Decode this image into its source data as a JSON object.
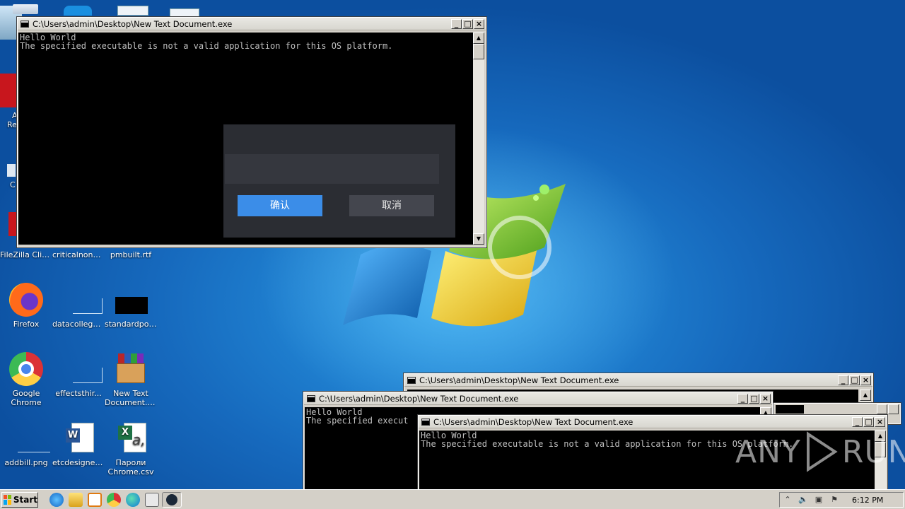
{
  "desktop_icons": [
    {
      "label": "FileZilla Client",
      "icon": "filezilla-icon"
    },
    {
      "label": "criticalnone....",
      "icon": "file-icon"
    },
    {
      "label": "pmbuilt.rtf",
      "icon": "rtf-icon"
    },
    {
      "label": "Firefox",
      "icon": "firefox-icon"
    },
    {
      "label": "datacollege....",
      "icon": "file-icon"
    },
    {
      "label": "standardpoi...",
      "icon": "image-icon"
    },
    {
      "label": "Google Chrome",
      "icon": "chrome-icon"
    },
    {
      "label": "effectsthir...",
      "icon": "file-icon"
    },
    {
      "label": "New Text Document.b...",
      "icon": "winrar-icon"
    },
    {
      "label": "addbill.png",
      "icon": "png-icon"
    },
    {
      "label": "etcdesigned...",
      "icon": "word-icon"
    },
    {
      "label": "Пароли Chrome.csv",
      "icon": "excel-icon"
    }
  ],
  "partial_icon_labels": [
    "Re",
    "A",
    "Re",
    "C"
  ],
  "main_console": {
    "title": "C:\\Users\\admin\\Desktop\\New Text Document.exe",
    "lines": [
      "Hello World",
      "The specified executable is not a valid application for this OS platform."
    ]
  },
  "dialog": {
    "confirm_label": "确认",
    "cancel_label": "取消"
  },
  "console_back": {
    "title": "C:\\Users\\admin\\Desktop\\New Text Document.exe"
  },
  "console_mid": {
    "title": "C:\\Users\\admin\\Desktop\\New Text Document.exe",
    "lines": [
      "Hello World",
      "The specified execut"
    ]
  },
  "console_front": {
    "title": "C:\\Users\\admin\\Desktop\\New Text Document.exe",
    "lines": [
      "Hello World",
      "The specified executable is not a valid application for this OS platform."
    ]
  },
  "titlebar_buttons": {
    "minimize": "_",
    "maximize": "□",
    "close": "×"
  },
  "taskbar": {
    "start_label": "Start",
    "clock": "6:12 PM",
    "quick_launch": [
      "ie-icon",
      "explorer-icon",
      "media-player-icon",
      "chrome-icon",
      "edge-icon",
      "console-icon",
      "steam-icon"
    ]
  },
  "watermark": {
    "left": "ANY",
    "right": "RUN"
  },
  "colors": {
    "confirm_button": "#3b8de8",
    "dialog_bg": "#2b2d33",
    "console_bg": "#000000"
  }
}
